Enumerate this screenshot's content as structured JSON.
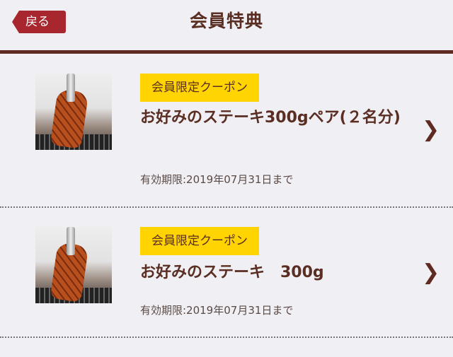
{
  "header": {
    "back_label": "戻る",
    "title": "会員特典"
  },
  "coupons": [
    {
      "tag": "会員限定クーポン",
      "title": "お好みのステーキ300gペア(２名分)",
      "expiry": "有効期限:2019年07月31日まで",
      "image": "steak-photo"
    },
    {
      "tag": "会員限定クーポン",
      "title": "お好みのステーキ　300g",
      "expiry": "有効期限:2019年07月31日まで",
      "image": "steak-photo"
    }
  ],
  "icons": {
    "chevron": "chevron-right-icon",
    "chevron_glyph": "❯"
  },
  "colors": {
    "accent_red": "#a8262e",
    "tag_yellow": "#ffd400",
    "text_brown": "#5a2e22",
    "background": "#f0eff4"
  }
}
